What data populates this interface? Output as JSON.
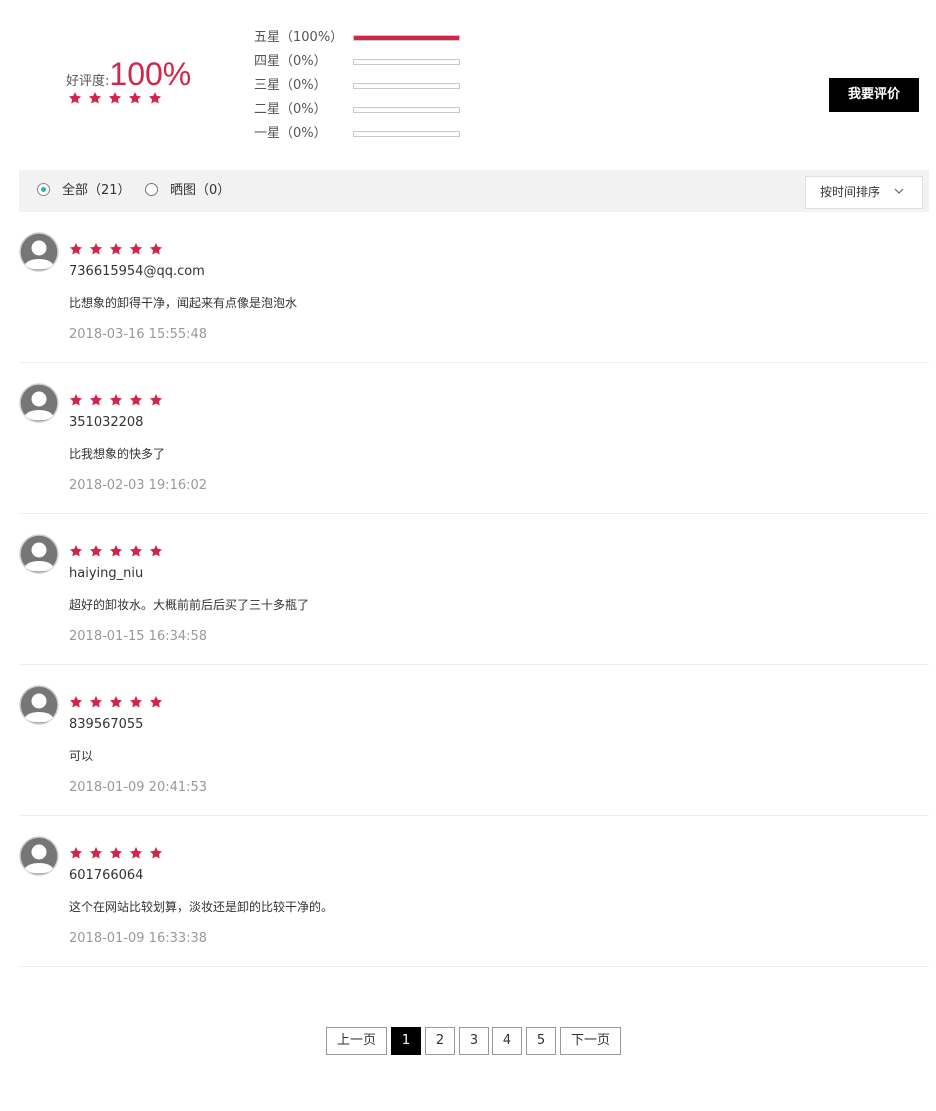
{
  "summary": {
    "good_rate_label": "好评度:",
    "good_rate_value": "100%",
    "rating_stars": 5,
    "distribution": [
      {
        "label": "五星（100%）",
        "percent": 100
      },
      {
        "label": "四星（0%）",
        "percent": 0
      },
      {
        "label": "三星（0%）",
        "percent": 0
      },
      {
        "label": "二星（0%）",
        "percent": 0
      },
      {
        "label": "一星（0%）",
        "percent": 0
      }
    ],
    "write_review_label": "我要评价"
  },
  "filters": {
    "all_label": "全部（21）",
    "photos_label": "晒图（0）",
    "selected": "all",
    "sort_label": "按时间排序"
  },
  "reviews": [
    {
      "stars": 5,
      "user": "736615954@qq.com",
      "text": "比想象的卸得干净，闻起来有点像是泡泡水",
      "time": "2018-03-16 15:55:48"
    },
    {
      "stars": 5,
      "user": "351032208",
      "text": "比我想象的快多了",
      "time": "2018-02-03 19:16:02"
    },
    {
      "stars": 5,
      "user": "haiying_niu",
      "text": "超好的卸妆水。大概前前后后买了三十多瓶了",
      "time": "2018-01-15 16:34:58"
    },
    {
      "stars": 5,
      "user": "839567055",
      "text": "可以",
      "time": "2018-01-09 20:41:53"
    },
    {
      "stars": 5,
      "user": "601766064",
      "text": "这个在网站比较划算，淡妆还是卸的比较干净的。",
      "time": "2018-01-09 16:33:38"
    }
  ],
  "pagination": {
    "prev_label": "上一页",
    "pages": [
      "1",
      "2",
      "3",
      "4",
      "5"
    ],
    "current": "1",
    "next_label": "下一页"
  },
  "colors": {
    "star": "#d3254a",
    "accent": "#d3254a",
    "radio_selected": "#2bb5a0",
    "button_bg": "#000000"
  },
  "icons": {
    "star": "star-icon",
    "avatar": "user-avatar-icon",
    "chevron": "chevron-down-icon"
  }
}
